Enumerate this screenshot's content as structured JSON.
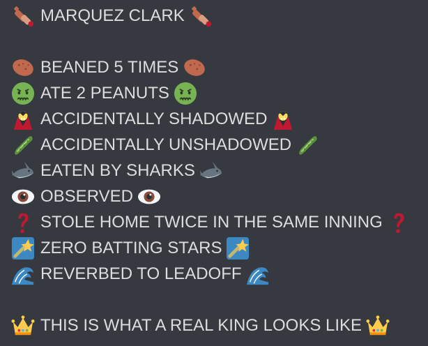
{
  "message": {
    "lines": [
      {
        "text": "MARQUEZ CLARK",
        "icon": "cricket-bat-icon"
      },
      {
        "text": "BEANED 5 TIMES",
        "icon": "potato-icon"
      },
      {
        "text": "ATE 2 PEANUTS",
        "icon": "nauseated-face-icon"
      },
      {
        "text": "ACCIDENTALLY SHADOWED",
        "icon": "vampire-icon"
      },
      {
        "text": "ACCIDENTALLY UNSHADOWED",
        "icon": "cucumber-icon"
      },
      {
        "text": "EATEN BY SHARKS",
        "icon": "shark-icon"
      },
      {
        "text": "OBSERVED",
        "icon": "eye-icon"
      },
      {
        "text": "STOLE HOME TWICE IN THE SAME INNING",
        "icon": "question-mark-icon"
      },
      {
        "text": "ZERO BATTING STARS",
        "icon": "shooting-star-icon"
      },
      {
        "text": "REVERBED TO LEADOFF",
        "icon": "water-wave-icon"
      },
      {
        "text": "THIS IS WHAT A REAL KING LOOKS LIKE",
        "icon": "crown-icon"
      }
    ]
  },
  "colors": {
    "background": "#36393f",
    "text": "#dcddde"
  }
}
